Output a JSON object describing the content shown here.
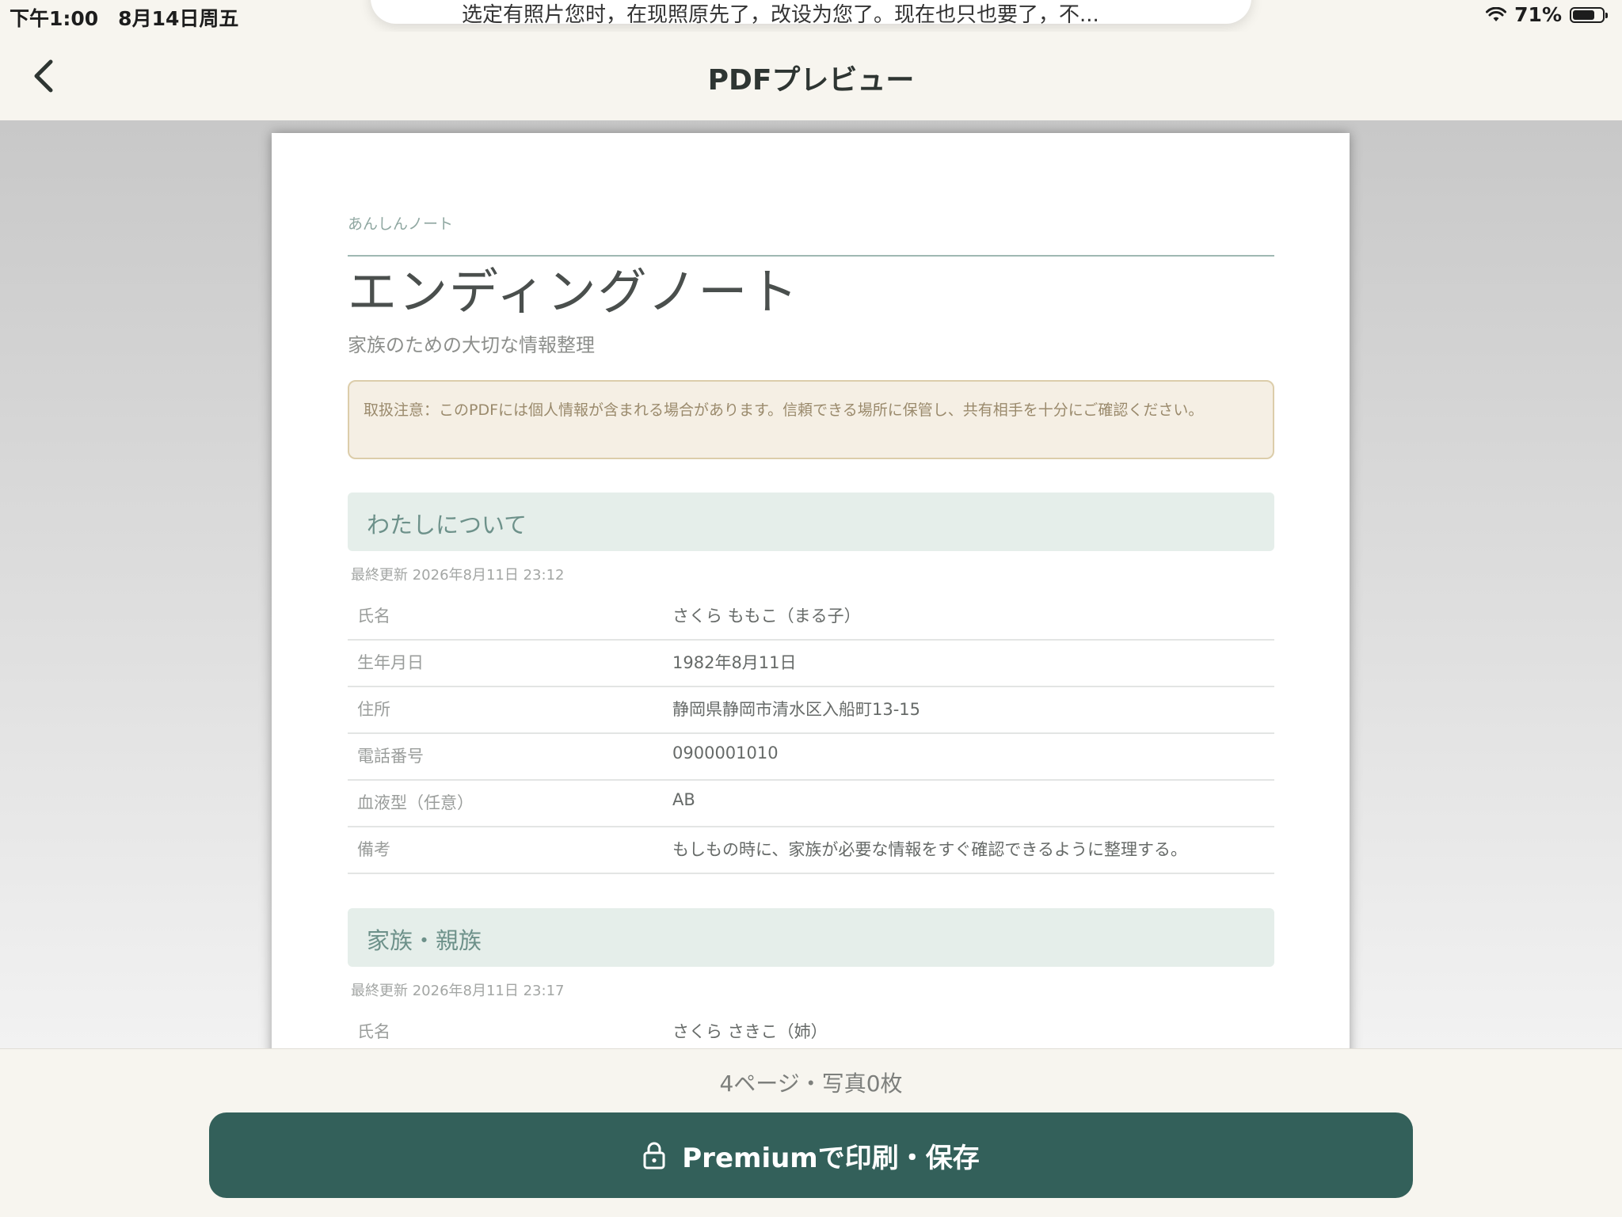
{
  "status_bar": {
    "time": "下午1:00　8月14日周五",
    "battery": "71%",
    "battery_level": 0.71
  },
  "notification": {
    "text": "选定有照片您时，在现照原先了，改设为您了。现在也只也要了，不..."
  },
  "nav": {
    "title": "PDFプレビュー",
    "back_icon": "chevron-left-icon"
  },
  "document": {
    "brand": "あんしんノート",
    "title": "エンディングノート",
    "subtitle": "家族のための大切な情報整理",
    "notice": "取扱注意：このPDFには個人情報が含まれる場合があります。信頼できる場所に保管し、共有相手を十分にご確認ください。",
    "sections": [
      {
        "title": "わたしについて",
        "updated": "最終更新 2026年8月11日 23:12",
        "rows": [
          {
            "label": "氏名",
            "value": "さくら ももこ（まる子）"
          },
          {
            "label": "生年月日",
            "value": "1982年8月11日"
          },
          {
            "label": "住所",
            "value": "静岡県静岡市清水区入船町13-15"
          },
          {
            "label": "電話番号",
            "value": "0900001010"
          },
          {
            "label": "血液型（任意）",
            "value": "AB"
          },
          {
            "label": "備考",
            "value": "もしもの時に、家族が必要な情報をすぐ確認できるように整理する。"
          }
        ]
      },
      {
        "title": "家族・親族",
        "updated": "最終更新 2026年8月11日 23:17",
        "rows": [
          {
            "label": "氏名",
            "value": "さくら さきこ（姉）"
          }
        ]
      }
    ]
  },
  "footer": {
    "page_info": "4ページ・写真0枚",
    "button_label": "Premiumで印刷・保存",
    "button_icon": "lock-icon",
    "accent_color": "#33605a"
  }
}
